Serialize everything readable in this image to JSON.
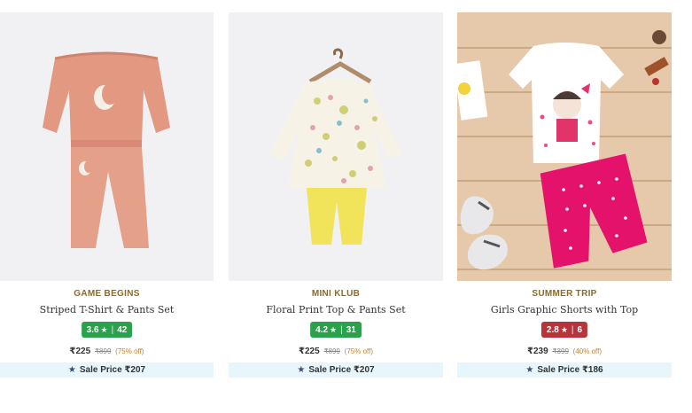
{
  "products": [
    {
      "brand": "GAME BEGINS",
      "name": "Striped T-Shirt & Pants Set",
      "rating": "3.6",
      "rating_count": "42",
      "rating_color": "#2aa14a",
      "price": "₹225",
      "mrp": "₹899",
      "discount": "(75% off)",
      "sale_label": "Sale Price ₹207",
      "image_icon": "pajama-set-image"
    },
    {
      "brand": "MINI KLUB",
      "name": "Floral Print Top & Pants Set",
      "rating": "4.2",
      "rating_count": "31",
      "rating_color": "#2aa14a",
      "price": "₹225",
      "mrp": "₹899",
      "discount": "(75% off)",
      "sale_label": "Sale Price ₹207",
      "image_icon": "floral-top-image"
    },
    {
      "brand": "SUMMER TRIP",
      "name": "Girls Graphic Shorts with Top",
      "rating": "2.8",
      "rating_count": "6",
      "rating_color": "#b8343b",
      "price": "₹239",
      "mrp": "₹399",
      "discount": "(40% off)",
      "sale_label": "Sale Price ₹186",
      "image_icon": "graphic-shorts-set-image"
    }
  ],
  "icons": {
    "rating_star": "star-icon",
    "sale_badge": "sale-star-icon"
  },
  "glyphs": {
    "star": "★",
    "separator": "|"
  }
}
